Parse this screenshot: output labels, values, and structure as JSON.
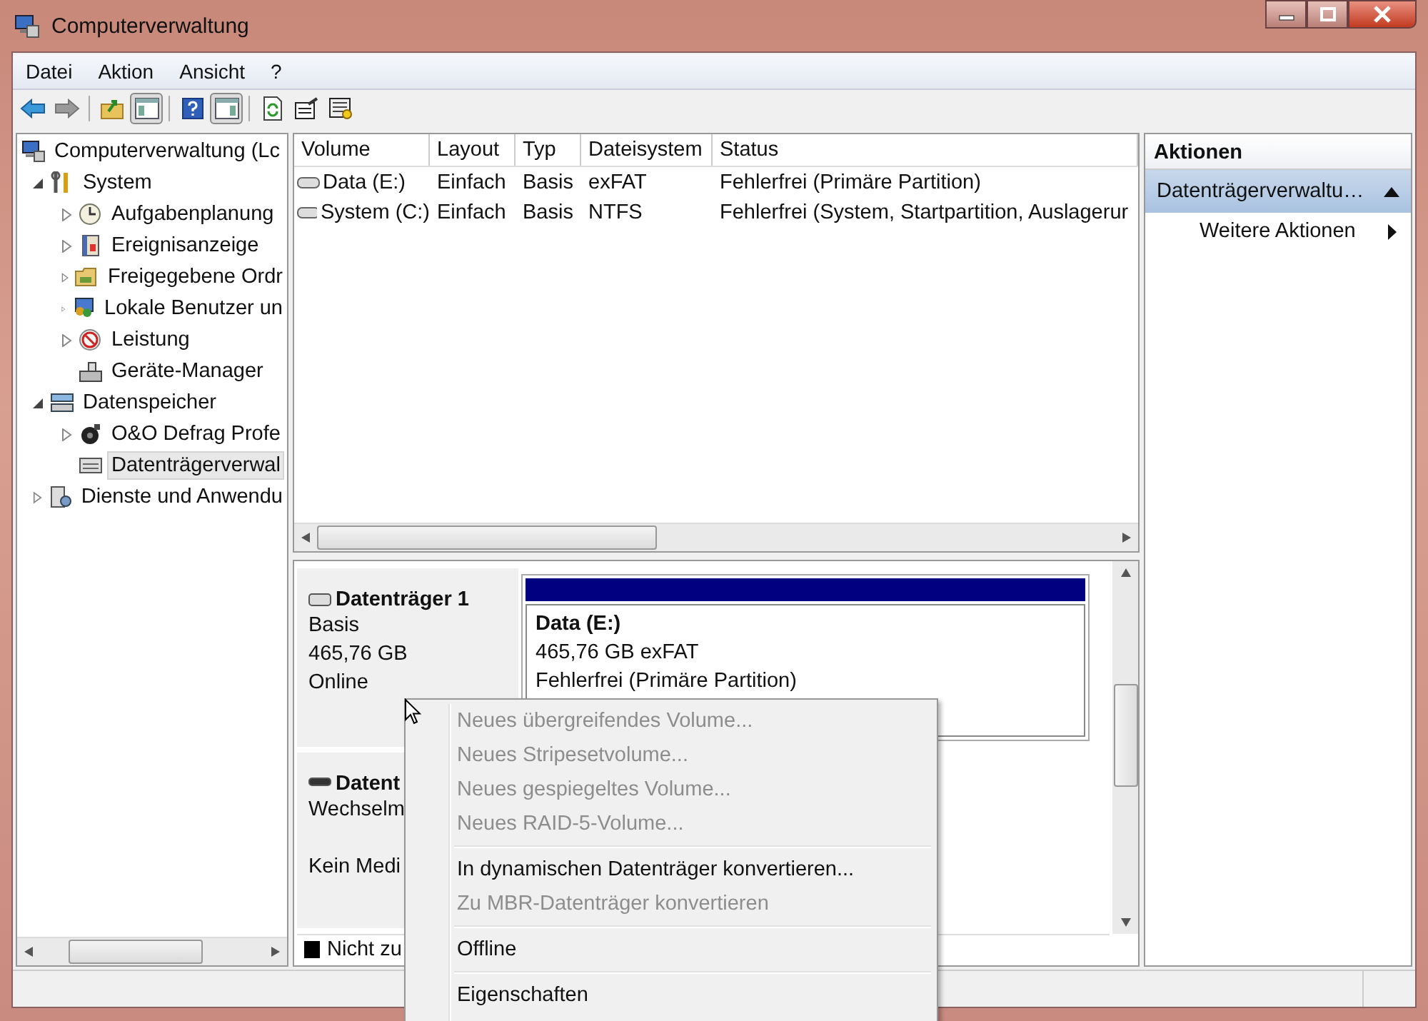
{
  "window": {
    "title": "Computerverwaltung"
  },
  "menu": [
    "Datei",
    "Aktion",
    "Ansicht",
    "?"
  ],
  "toolbar": [
    {
      "kind": "back",
      "disabled": false
    },
    {
      "kind": "forward",
      "disabled": true
    },
    {
      "kind": "separator"
    },
    {
      "kind": "up"
    },
    {
      "kind": "tree-toggle",
      "pressed": true
    },
    {
      "kind": "separator"
    },
    {
      "kind": "help"
    },
    {
      "kind": "pane-toggle",
      "pressed": true
    },
    {
      "kind": "separator"
    },
    {
      "kind": "refresh"
    },
    {
      "kind": "properties"
    },
    {
      "kind": "export"
    }
  ],
  "tree": [
    {
      "label": "Computerverwaltung (Lc",
      "selected": false,
      "children": [
        {
          "label": "System",
          "expanded": true,
          "selected": false,
          "children": [
            {
              "label": "Aufgabenplanung",
              "expanded": false,
              "selected": false
            },
            {
              "label": "Ereignisanzeige",
              "expanded": false,
              "selected": false
            },
            {
              "label": "Freigegebene Ordr",
              "expanded": false,
              "selected": false
            },
            {
              "label": "Lokale Benutzer un",
              "expanded": false,
              "selected": false
            },
            {
              "label": "Leistung",
              "expanded": false,
              "selected": false
            },
            {
              "label": "Geräte-Manager",
              "selected": false
            }
          ]
        },
        {
          "label": "Datenspeicher",
          "expanded": true,
          "selected": false,
          "children": [
            {
              "label": "O&O Defrag Profe",
              "expanded": false,
              "selected": false
            },
            {
              "label": "Datenträgerverwal",
              "selected": true
            }
          ]
        },
        {
          "label": "Dienste und Anwendu",
          "expanded": false,
          "selected": false
        }
      ]
    }
  ],
  "table": {
    "columns": [
      "Volume",
      "Layout",
      "Typ",
      "Dateisystem",
      "Status"
    ],
    "rows": [
      [
        "Data (E:)",
        "Einfach",
        "Basis",
        "exFAT",
        "Fehlerfrei (Primäre Partition)"
      ],
      [
        "System (C:)",
        "Einfach",
        "Basis",
        "NTFS",
        "Fehlerfrei (System, Startpartition, Auslagerur"
      ]
    ]
  },
  "disks": [
    {
      "title": "Datenträger 1",
      "type": "Basis",
      "size": "465,76 GB",
      "status": "Online",
      "removable": false,
      "partitions": [
        {
          "title": "Data  (E:)",
          "size": "465,76 GB exFAT",
          "status": "Fehlerfrei (Primäre Partition)",
          "color": "#000080"
        }
      ]
    },
    {
      "title": "Datent",
      "type": "Wechselm",
      "status": "Kein Medi",
      "removable": true
    }
  ],
  "legend": [
    {
      "label": "Nicht zu",
      "color": "#000000"
    }
  ],
  "actions": {
    "title": "Aktionen",
    "section": {
      "label": "Datenträgerverwaltu…",
      "expanded": true
    },
    "items": [
      {
        "label": "Weitere Aktionen",
        "submenu": true
      }
    ]
  },
  "context_menu": [
    [
      {
        "label": "Neues übergreifendes Volume...",
        "disabled": true
      },
      {
        "label": "Neues Stripesetvolume...",
        "disabled": true
      },
      {
        "label": "Neues gespiegeltes Volume...",
        "disabled": true
      },
      {
        "label": "Neues RAID-5-Volume...",
        "disabled": true
      }
    ],
    [
      {
        "label": "In dynamischen Datenträger konvertieren...",
        "disabled": false
      },
      {
        "label": "Zu MBR-Datenträger konvertieren",
        "disabled": true
      }
    ],
    [
      {
        "label": "Offline",
        "disabled": false
      }
    ],
    [
      {
        "label": "Eigenschaften",
        "disabled": false
      }
    ]
  ]
}
